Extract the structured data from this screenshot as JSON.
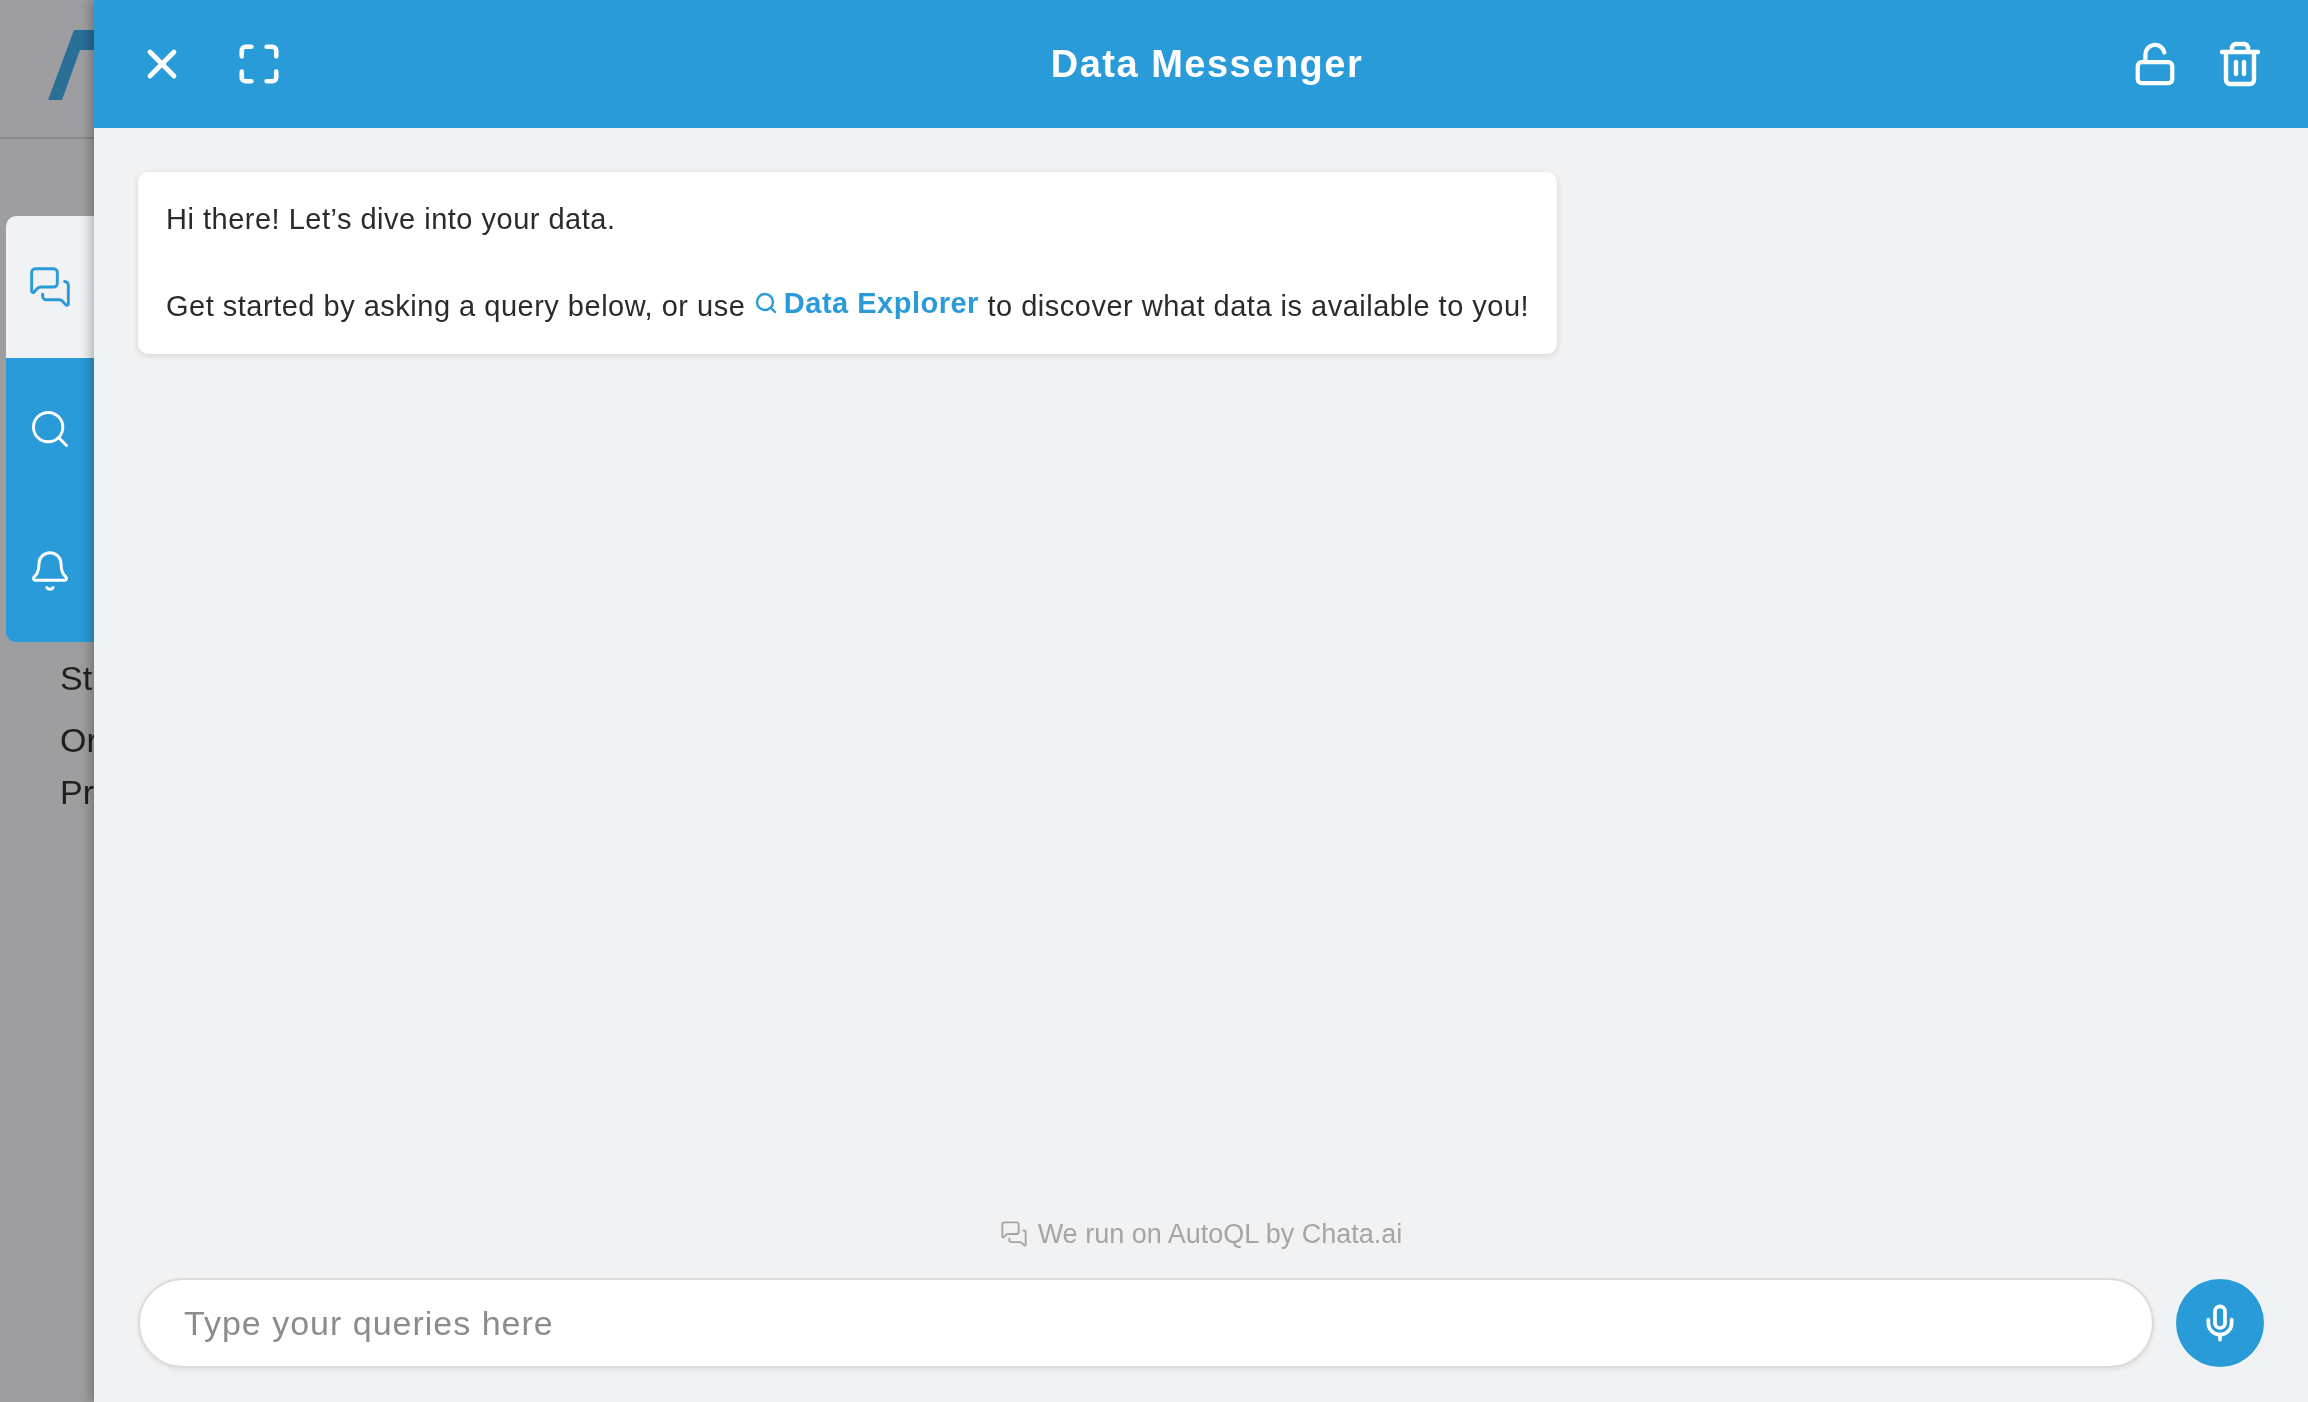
{
  "background_page": {
    "texts": [
      "St",
      "Or",
      "Pr"
    ]
  },
  "sidebar_tabs": [
    {
      "selected": true
    },
    {
      "selected": false
    },
    {
      "selected": false
    }
  ],
  "header": {
    "title": "Data Messenger"
  },
  "message": {
    "greeting": "Hi there! Let’s dive into your data.",
    "prompt_before": "Get started by asking a query below, or use",
    "link": "Data Explorer",
    "prompt_after": "to discover what data is available to you!"
  },
  "footer": {
    "credit": "We run on AutoQL by Chata.ai"
  },
  "query_input": {
    "placeholder": "Type your queries here"
  }
}
